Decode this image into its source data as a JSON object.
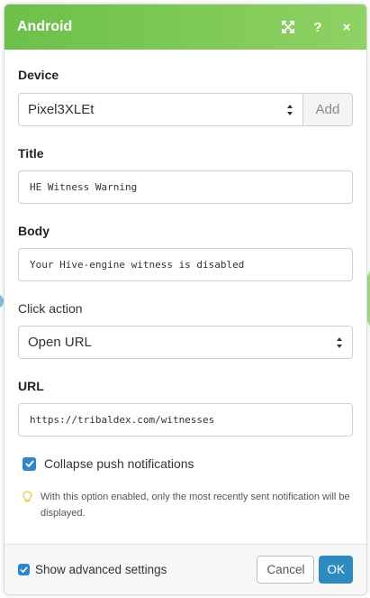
{
  "header": {
    "title": "Android",
    "expand_icon": "expand-icon",
    "help_label": "?",
    "close_label": "×"
  },
  "device": {
    "label": "Device",
    "value": "Pixel3XLEt",
    "add_label": "Add"
  },
  "title_field": {
    "label": "Title",
    "value": "HE Witness Warning"
  },
  "body_field": {
    "label": "Body",
    "value": "Your Hive-engine witness is disabled"
  },
  "click_action": {
    "label": "Click action",
    "value": "Open URL"
  },
  "url_field": {
    "label": "URL",
    "value": "https://tribaldex.com/witnesses"
  },
  "collapse": {
    "label": "Collapse push notifications",
    "checked": true
  },
  "hint": {
    "text": "With this option enabled, only the most recently sent notification will be displayed.",
    "icon": "lightbulb-icon"
  },
  "footer": {
    "advanced_label": "Show advanced settings",
    "advanced_checked": true,
    "cancel_label": "Cancel",
    "ok_label": "OK"
  },
  "colors": {
    "header_start": "#6cc04a",
    "header_end": "#8fd164",
    "primary": "#2f8bbf",
    "checkbox": "#2f86c9"
  }
}
